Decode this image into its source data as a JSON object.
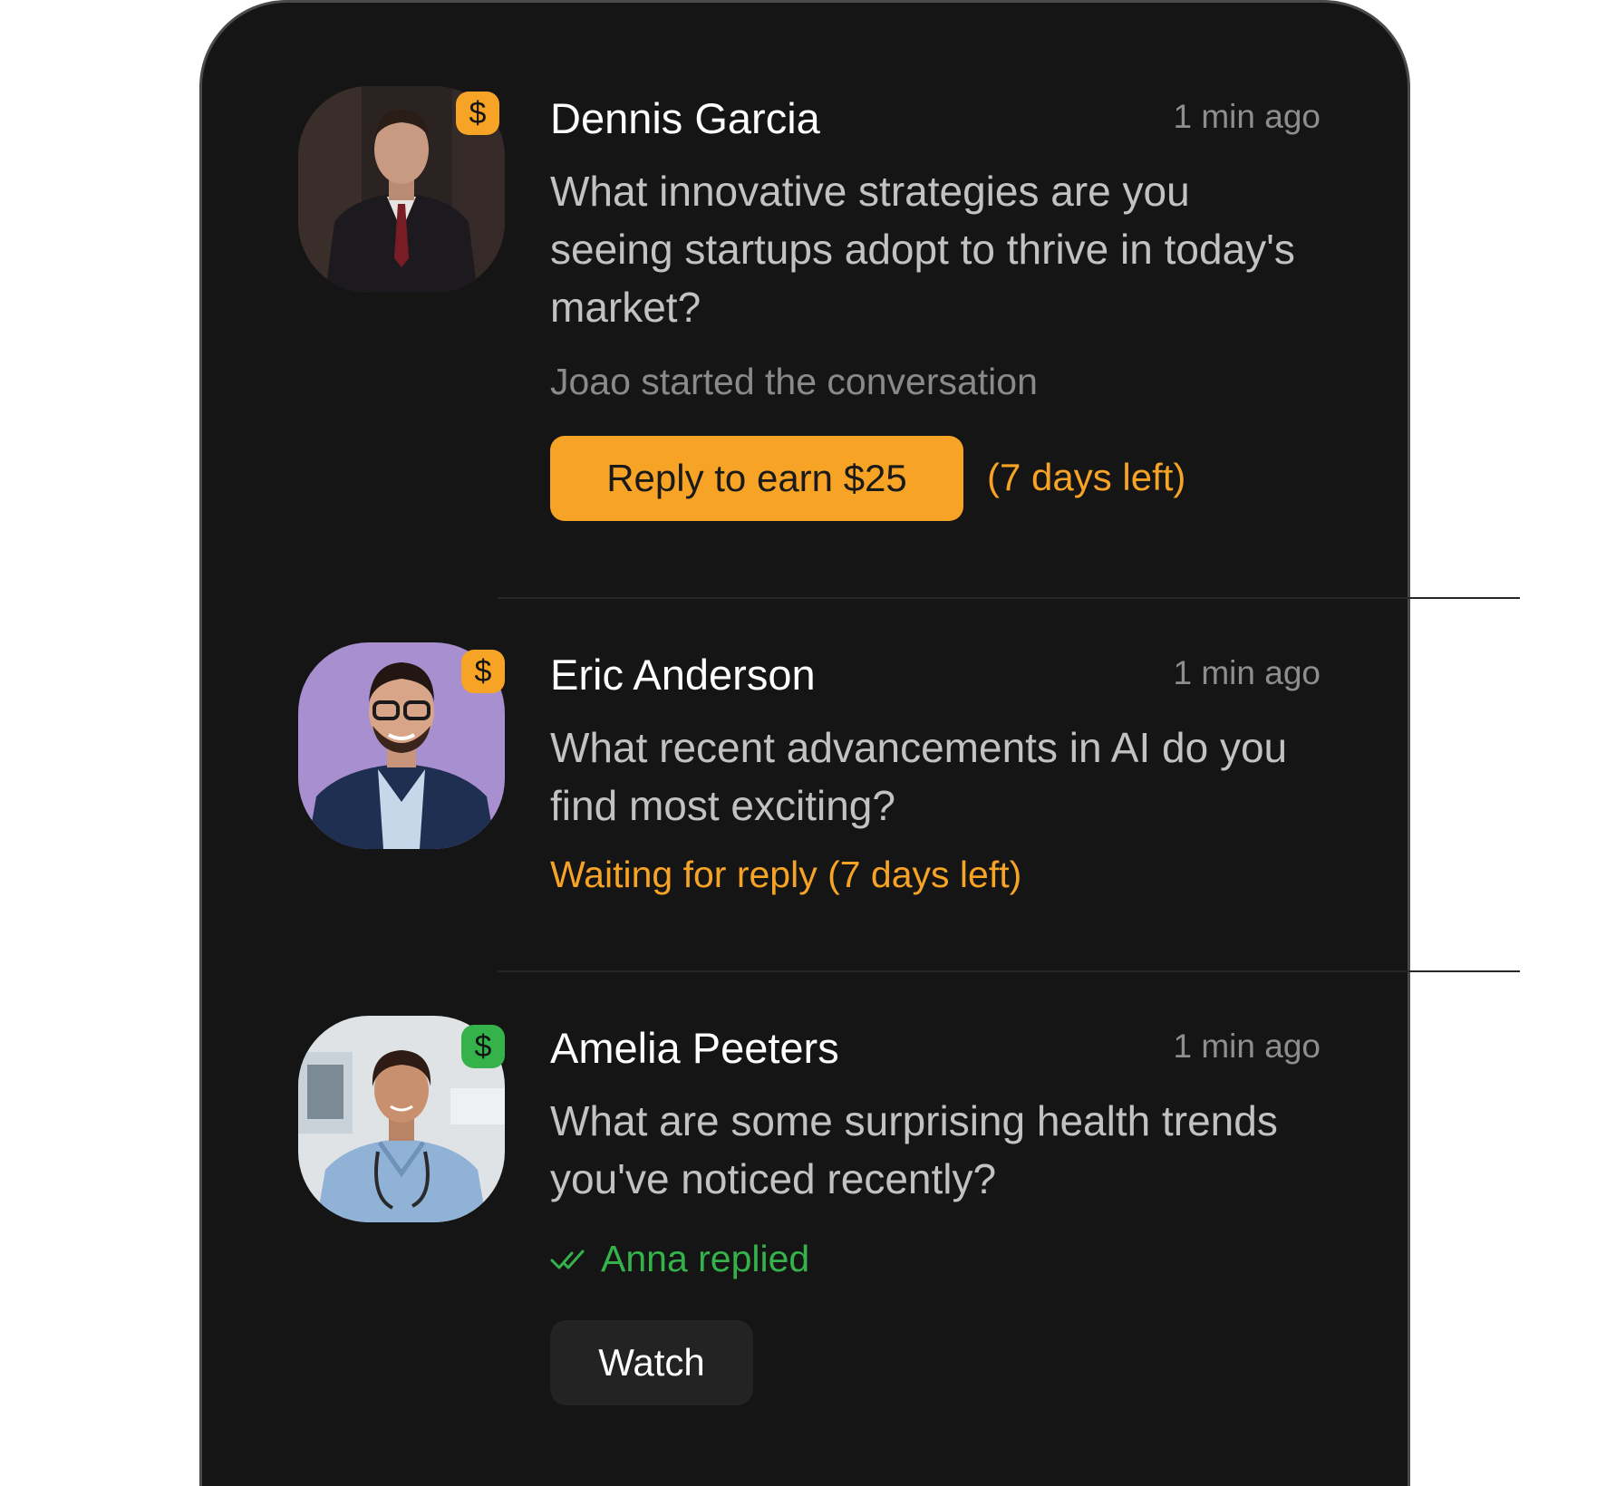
{
  "conversations": [
    {
      "name": "Dennis Garcia",
      "time": "1 min ago",
      "question": "What innovative strategies are you seeing startups adopt to thrive in today's market?",
      "starter": "Joao started the conversation",
      "reply_button": "Reply to earn $25",
      "days_left": "(7 days left)",
      "badge_symbol": "$",
      "badge_color": "#f7a325"
    },
    {
      "name": "Eric Anderson",
      "time": "1 min ago",
      "question": "What recent advancements in AI do you find most exciting?",
      "status": "Waiting for reply (7 days left)",
      "badge_symbol": "$",
      "badge_color": "#f7a325"
    },
    {
      "name": "Amelia Peeters",
      "time": "1 min ago",
      "question": "What are some surprising health trends you've noticed recently?",
      "status": "Anna replied",
      "watch_button": "Watch",
      "badge_symbol": "$",
      "badge_color": "#35b34a"
    }
  ],
  "colors": {
    "card_background": "#151515",
    "accent_orange": "#f7a325",
    "accent_green": "#35b34a"
  },
  "icons": [
    "dollar-icon",
    "double-check-icon"
  ]
}
